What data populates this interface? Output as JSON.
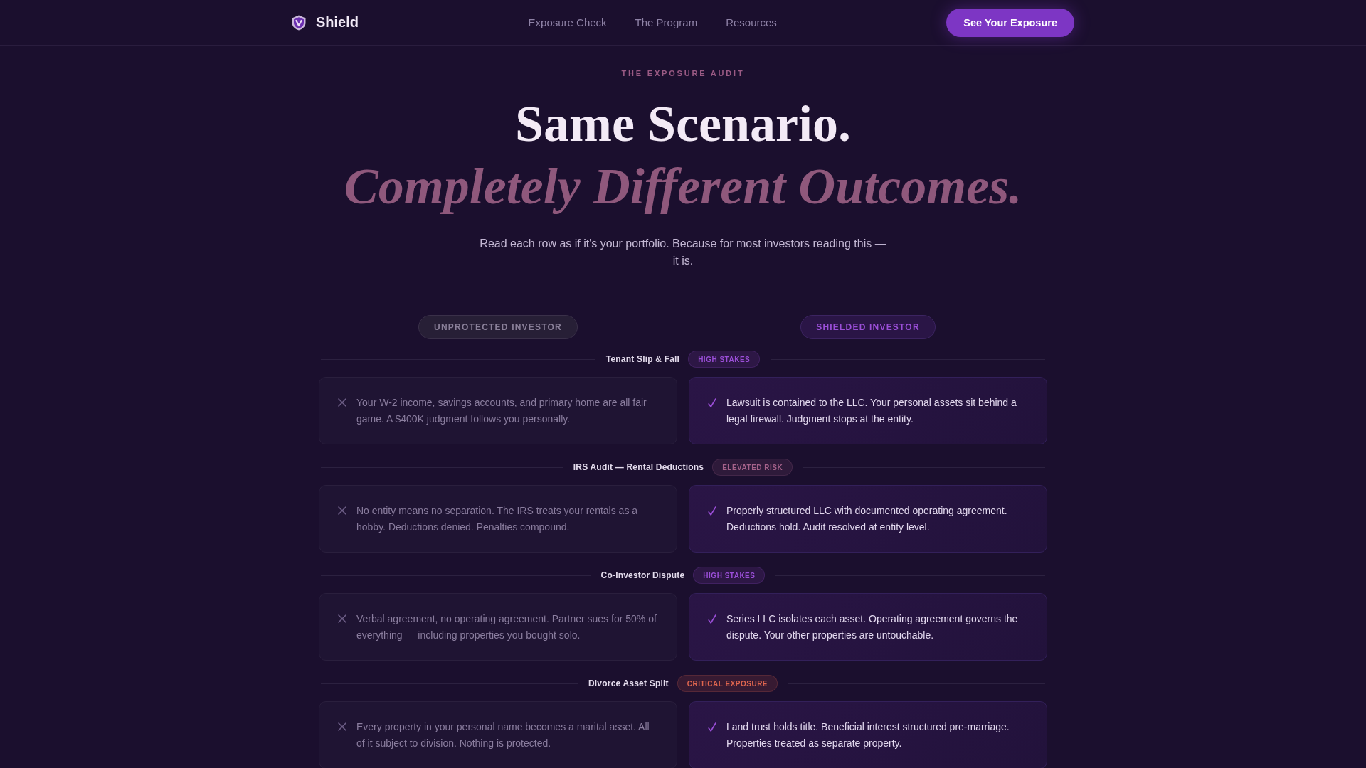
{
  "header": {
    "brand": "Shield",
    "nav": [
      "Exposure Check",
      "The Program",
      "Resources"
    ],
    "cta": "See Your Exposure"
  },
  "hero": {
    "eyebrow": "THE EXPOSURE AUDIT",
    "title": "Same Scenario.",
    "title_accent": "Completely Different Outcomes.",
    "subtitle": "Read each row as if it's your portfolio. Because for most investors reading this — it is."
  },
  "columns": [
    {
      "label": "UNPROTECTED INVESTOR",
      "kind": "unprotected"
    },
    {
      "label": "SHIELDED INVESTOR",
      "kind": "shielded"
    }
  ],
  "scenarios": [
    {
      "title": "Tenant Slip & Fall",
      "tag": {
        "label": "HIGH STAKES",
        "color": "#9b4fd8"
      },
      "outcomes": [
        {
          "kind": "unprotected",
          "text": "Your W-2 income, savings accounts, and primary home are all fair game. A $400K judgment follows you personally."
        },
        {
          "kind": "shielded",
          "text": "Lawsuit is contained to the LLC. Your personal assets sit behind a legal firewall. Judgment stops at the entity."
        }
      ]
    },
    {
      "title": "IRS Audit — Rental Deductions",
      "tag": {
        "label": "ELEVATED RISK",
        "color": "#a5628a"
      },
      "outcomes": [
        {
          "kind": "unprotected",
          "text": "No entity means no separation. The IRS treats your rentals as a hobby. Deductions denied. Penalties compound."
        },
        {
          "kind": "shielded",
          "text": "Properly structured LLC with documented operating agreement. Deductions hold. Audit resolved at entity level."
        }
      ]
    },
    {
      "title": "Co-Investor Dispute",
      "tag": {
        "label": "HIGH STAKES",
        "color": "#9b4fd8"
      },
      "outcomes": [
        {
          "kind": "unprotected",
          "text": "Verbal agreement, no operating agreement. Partner sues for 50% of everything — including properties you bought solo."
        },
        {
          "kind": "shielded",
          "text": "Series LLC isolates each asset. Operating agreement governs the dispute. Your other properties are untouchable."
        }
      ]
    },
    {
      "title": "Divorce Asset Split",
      "tag": {
        "label": "CRITICAL EXPOSURE",
        "color": "#e0664f"
      },
      "outcomes": [
        {
          "kind": "unprotected",
          "text": "Every property in your personal name becomes a marital asset. All of it subject to division. Nothing is protected."
        },
        {
          "kind": "shielded",
          "text": "Land trust holds title. Beneficial interest structured pre-marriage. Properties treated as separate property."
        }
      ]
    }
  ]
}
